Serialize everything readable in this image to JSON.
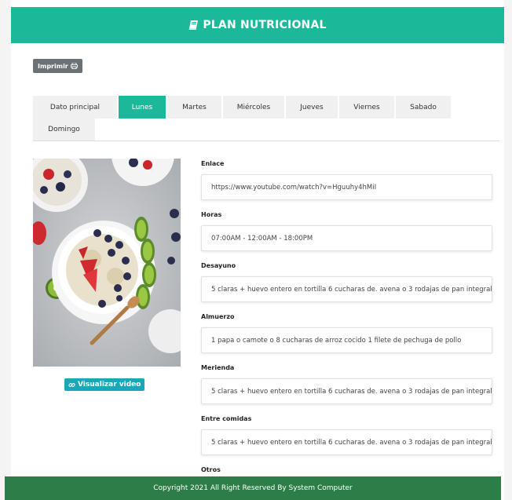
{
  "header": {
    "title": "PLAN NUTRICIONAL",
    "icon": "book-icon"
  },
  "toolbar": {
    "print_label": "Imprimir",
    "print_icon": "printer-icon"
  },
  "tabs": [
    {
      "label": "Dato principal"
    },
    {
      "label": "Lunes",
      "active": true
    },
    {
      "label": "Martes"
    },
    {
      "label": "Miércoles"
    },
    {
      "label": "Jueves"
    },
    {
      "label": "Viernes"
    },
    {
      "label": "Sabado"
    },
    {
      "label": "Domingo"
    }
  ],
  "media": {
    "video_label": "Visualizar video",
    "video_icon": "link-icon"
  },
  "fields": [
    {
      "label": "Enlace",
      "value": "https://www.youtube.com/watch?v=Hguuhy4hMiI"
    },
    {
      "label": "Horas",
      "value": "07:00AM - 12:00AM - 18:00PM"
    },
    {
      "label": "Desayuno",
      "value": "5 claras + huevo entero en tortilla 6 cucharas de. avena o 3 rodajas de pan integral"
    },
    {
      "label": "Almuerzo",
      "value": "1 papa o camote o 8 cucharas de arroz cocido 1 filete de pechuga de pollo"
    },
    {
      "label": "Merienda",
      "value": "5 claras + huevo entero en tortilla 6 cucharas de. avena o 3 rodajas de pan integral"
    },
    {
      "label": "Entre comidas",
      "value": "5 claras + huevo entero en tortilla 6 cucharas de. avena o 3 rodajas de pan integral"
    },
    {
      "label": "Otros",
      "value": ""
    }
  ],
  "footer": {
    "text": "Copyright 2021 All Right Reserved By System Computer"
  },
  "colors": {
    "accent": "#1bb99a",
    "footer": "#2d7d46",
    "video_button": "#1aa8b8",
    "print_button": "#6b7277"
  }
}
